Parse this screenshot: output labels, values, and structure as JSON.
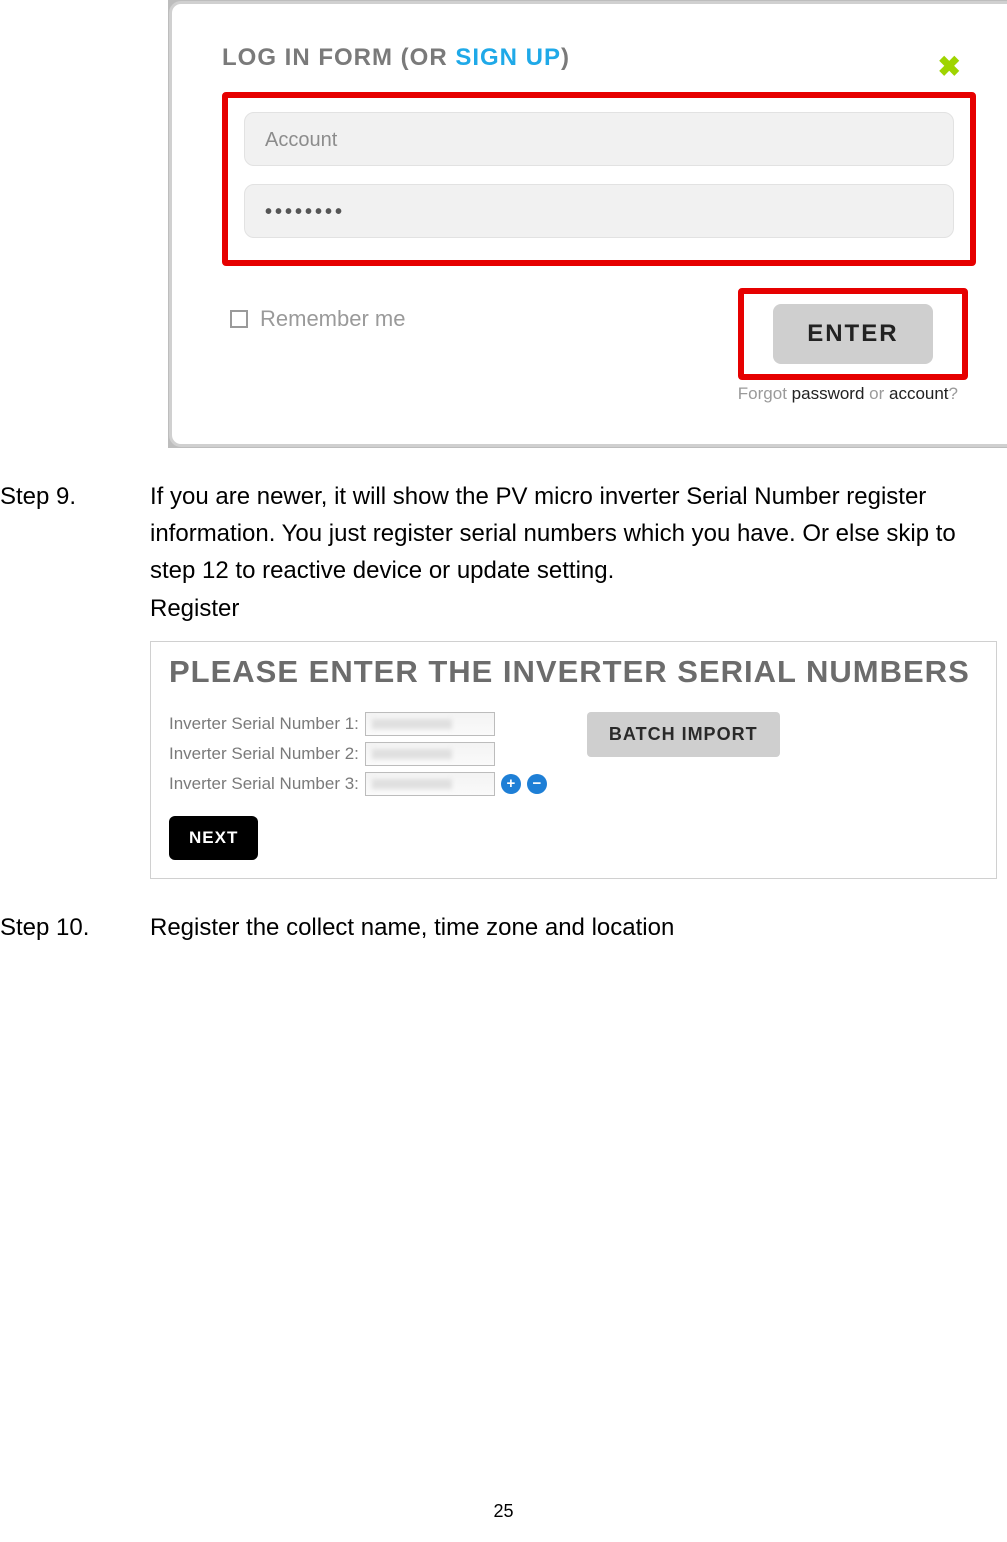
{
  "login": {
    "title_prefix": "LOG IN FORM (OR ",
    "title_link": "SIGN UP",
    "title_suffix": ")",
    "account_placeholder": "Account",
    "password_mask": "••••••••",
    "remember_label": "Remember me",
    "enter_label": "ENTER",
    "forgot_prefix": "Forgot ",
    "forgot_pw": "password",
    "forgot_mid": " or ",
    "forgot_acct": "account",
    "forgot_suffix": "?"
  },
  "step9": {
    "label": "Step 9.",
    "text1": "If you are newer, it will show the PV micro inverter Serial Number register information. You just register serial numbers which you have. Or else skip to step 12 to reactive device or update setting.",
    "text2": "Register"
  },
  "serial": {
    "title": "PLEASE ENTER THE INVERTER SERIAL NUMBERS",
    "rows": [
      {
        "label": "Inverter Serial Number 1:"
      },
      {
        "label": "Inverter Serial Number 2:"
      },
      {
        "label": "Inverter Serial Number 3:"
      }
    ],
    "batch_label": "BATCH IMPORT",
    "next_label": "NEXT"
  },
  "step10": {
    "label": "Step 10.",
    "text": "Register the collect name, time zone and location"
  },
  "page_number": "25"
}
